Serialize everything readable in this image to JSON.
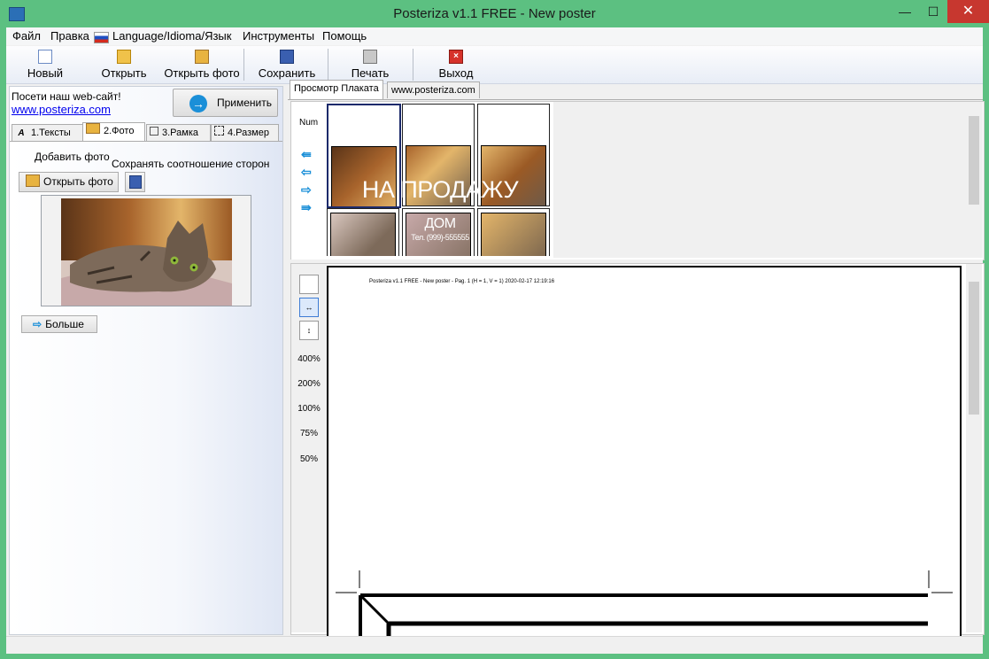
{
  "window": {
    "title": "Posteriza v1.1 FREE - New poster",
    "minimize": "—",
    "maximize": "☐",
    "close": "✕"
  },
  "menu": {
    "file": "Файл",
    "edit": "Правка",
    "language": "Language/Idioma/Язык",
    "tools": "Инструменты",
    "help": "Помощь"
  },
  "toolbar": {
    "new": "Новый",
    "open": "Открыть",
    "open_photo": "Открыть фото",
    "save": "Сохранить",
    "print": "Печать",
    "exit": "Выход"
  },
  "left": {
    "visit_text": "Посети наш web-сайт!",
    "site_link": "www.posteriza.com",
    "apply": "Применить",
    "tabs": [
      "1.Тексты",
      "2.Фото",
      "3.Рамка",
      "4.Размер"
    ],
    "add_photo": "Добавить фото",
    "keep_ratio": "Сохранять соотношение сторон",
    "open_photo": "Открыть фото",
    "more": "Больше"
  },
  "right": {
    "tabs": [
      "Просмотр Плаката",
      "www.posteriza.com"
    ],
    "num": "Num",
    "poster_title": "НА ПРОДАЖУ",
    "poster_sub": "ДОМ",
    "poster_tel": "Тел. (999)-555555",
    "zoom_levels": [
      "400%",
      "200%",
      "100%",
      "75%",
      "50%"
    ],
    "page_header": "Posteriza v1.1  FREE  - New poster -  Pag. 1 (H = 1, V = 1)  2020-02-17   12:19:16"
  },
  "colors": {
    "titlebar": "#5cc081",
    "close": "#c7372f",
    "link": "#0000ee",
    "accent": "#1a8fd8"
  },
  "icons": [
    "app-icon",
    "flag-icon",
    "new-doc-icon",
    "open-folder-icon",
    "open-photo-icon",
    "save-disk-icon",
    "printer-icon",
    "exit-icon",
    "apply-arrow-icon",
    "text-tab-icon",
    "photo-tab-icon",
    "frame-tab-icon",
    "size-tab-icon",
    "arrow-icon"
  ]
}
